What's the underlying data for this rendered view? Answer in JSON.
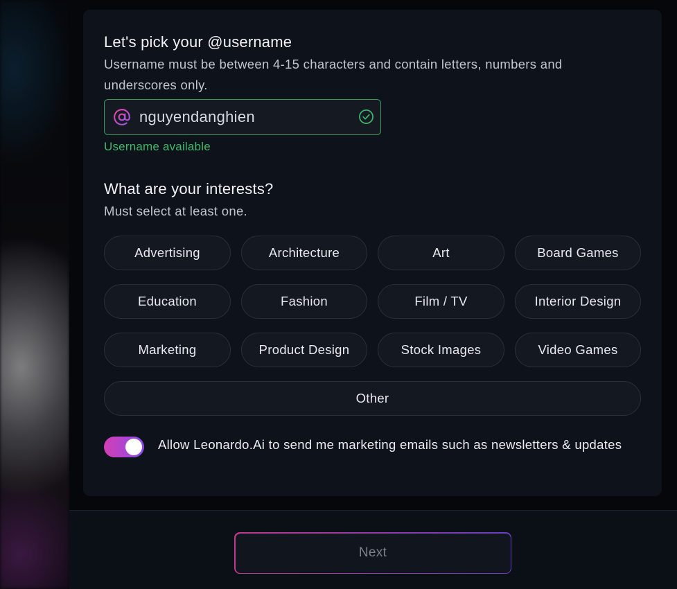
{
  "username": {
    "title": "Let's pick your @username",
    "description": "Username must be between 4-15 characters and contain letters, numbers and underscores only.",
    "value": "nguyendanghien",
    "status": "Username available",
    "at_icon": "at-sign-icon",
    "status_icon": "check-circle-icon"
  },
  "interests": {
    "title": "What are your interests?",
    "description": "Must select at least one.",
    "chips": [
      "Advertising",
      "Architecture",
      "Art",
      "Board Games",
      "Education",
      "Fashion",
      "Film / TV",
      "Interior Design",
      "Marketing",
      "Product Design",
      "Stock Images",
      "Video Games",
      "Other"
    ]
  },
  "marketing": {
    "label": "Allow Leonardo.Ai to send me marketing emails such as newsletters & updates",
    "enabled": true
  },
  "footer": {
    "next_label": "Next"
  },
  "colors": {
    "accent_pink": "#d33fb4",
    "accent_purple": "#8b4be8",
    "success_green": "#3fb86b"
  }
}
